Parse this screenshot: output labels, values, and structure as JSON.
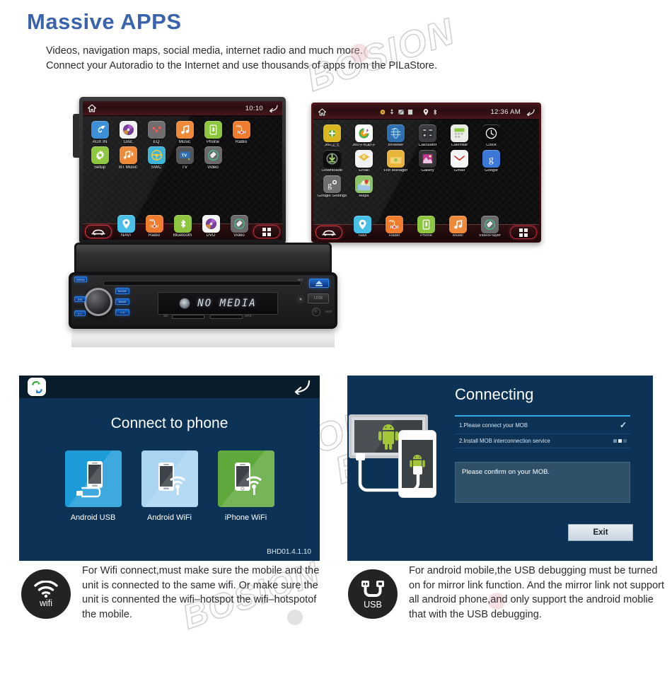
{
  "header": {
    "title": "Massive APPS",
    "title_color": "#3b63ad",
    "lines": [
      "Videos, navigation maps, social media, internet radio and much more.",
      "Connect your Autoradio to the Internet and use thousands of apps from the PILaStore."
    ]
  },
  "watermark": {
    "text": "BOSION"
  },
  "left_screen": {
    "statusbar": {
      "time": "10:10",
      "home_icon": "home-icon",
      "back_icon": "back-arrow-icon"
    },
    "apps": [
      {
        "label": "AUX IN",
        "icon": "aux-plug-icon",
        "color": "#3d8fd8"
      },
      {
        "label": "Disc",
        "icon": "disc-icon",
        "color": "#f2f2f2"
      },
      {
        "label": "EQ",
        "icon": "equalizer-icon",
        "color": "#6e6e70"
      },
      {
        "label": "Music",
        "icon": "music-note-icon",
        "color": "#ef8a3a"
      },
      {
        "label": "Phone",
        "icon": "bluetooth-phone-icon",
        "color": "#8ec63f"
      },
      {
        "label": "Radio",
        "icon": "fm-radio-icon",
        "color": "#f07d2e"
      },
      {
        "label": "Setup",
        "icon": "gear-icon",
        "color": "#8ec63f"
      },
      {
        "label": "BT Music",
        "icon": "bt-music-icon",
        "color": "#ef8a3a"
      },
      {
        "label": "SWC",
        "icon": "steering-wheel-icon",
        "color": "#3fb3d8"
      },
      {
        "label": "TV",
        "icon": "tv-icon",
        "color": "#555558"
      },
      {
        "label": "Video",
        "icon": "video-icon",
        "color": "#6a6a6d"
      }
    ],
    "dock": [
      {
        "label": "NAVI",
        "icon": "map-pin-icon",
        "color": "#49c0e8"
      },
      {
        "label": "Radio",
        "icon": "fm-radio-icon",
        "color": "#f07d2e"
      },
      {
        "label": "Bluetooth",
        "icon": "bluetooth-icon",
        "color": "#8ec63f"
      },
      {
        "label": "DVD",
        "icon": "disc-icon",
        "color": "#f4f4f4"
      },
      {
        "label": "Video",
        "icon": "video-icon",
        "color": "#6a6a6d"
      }
    ],
    "dock_left_icon": "car-icon",
    "dock_right_icon": "app-grid-icon"
  },
  "right_screen": {
    "statusbar": {
      "time": "12:36 AM",
      "home_icon": "home-icon",
      "back_icon": "back-arrow-icon",
      "icons": [
        "sync-icon",
        "usb-icon",
        "sd-card-icon",
        "battery-icon",
        "location-icon",
        "bluetooth-icon"
      ]
    },
    "apps": [
      {
        "label": "360卫土",
        "icon": "360-security-icon",
        "color": "#d9b521"
      },
      {
        "label": "360手机助手",
        "icon": "360-assistant-icon",
        "color": "#fbfbfb"
      },
      {
        "label": "Browser",
        "icon": "globe-browser-icon",
        "color": "#2f6fb0"
      },
      {
        "label": "Calculator",
        "icon": "calculator-icon",
        "color": "#3d3d40"
      },
      {
        "label": "Calendar",
        "icon": "calendar-icon",
        "color": "#e9eae4"
      },
      {
        "label": "Clock",
        "icon": "clock-icon",
        "color": "#0d0d0e"
      },
      {
        "label": "Downloads",
        "icon": "download-icon",
        "color": "#0d0d0e"
      },
      {
        "label": "Email",
        "icon": "email-icon",
        "color": "#f2f2f2"
      },
      {
        "label": "File Manager",
        "icon": "folder-icon",
        "color": "#e8b53a"
      },
      {
        "label": "Gallery",
        "icon": "gallery-icon",
        "color": "#333336"
      },
      {
        "label": "Gmail",
        "icon": "gmail-icon",
        "color": "#f4f4f4"
      },
      {
        "label": "Google",
        "icon": "google-g-icon",
        "color": "#3b78d8"
      },
      {
        "label": "Google Settings",
        "icon": "google-settings-icon",
        "color": "#6f6f72"
      },
      {
        "label": "Maps",
        "icon": "maps-icon",
        "color": "#8ec26a"
      }
    ],
    "dock": [
      {
        "label": "Navi",
        "icon": "map-pin-icon",
        "color": "#49c0e8"
      },
      {
        "label": "Radio",
        "icon": "fm-radio-icon",
        "color": "#f07d2e"
      },
      {
        "label": "Phone",
        "icon": "bluetooth-phone-icon",
        "color": "#8ec63f"
      },
      {
        "label": "Music",
        "icon": "music-note-icon",
        "color": "#ef8a3a"
      },
      {
        "label": "VideoPlayer",
        "icon": "video-icon",
        "color": "#6a6a6d"
      }
    ],
    "dock_left_icon": "car-icon",
    "dock_right_icon": "app-grid-icon"
  },
  "head_unit": {
    "display_text": "NO MEDIA",
    "keys_left": [
      "MENU",
      "DIS",
      "|<<"
    ],
    "keys_right": [
      "MODE",
      "BAND",
      ">>|"
    ],
    "usb_label": "USB",
    "aux_label": "AUX",
    "sd_label": "SD",
    "gps_label": "GPS",
    "eject_icon": "eject-icon",
    "reset_label": "RESET",
    "mic_label": "MIC"
  },
  "connect_panel": {
    "app_icon": "mirror-link-icon",
    "back_icon": "back-arrow-icon",
    "title": "Connect to phone",
    "version": "BHD01.4.1.10",
    "options": [
      {
        "label": "Android USB",
        "icon": "phone-usb-icon",
        "color": "#1d9bd8"
      },
      {
        "label": "Android WiFi",
        "icon": "phone-wifi-icon",
        "color": "#a9d5f2"
      },
      {
        "label": "iPhone WiFi",
        "icon": "iphone-wifi-icon",
        "color": "#5fa83c"
      }
    ]
  },
  "connecting_panel": {
    "title": "Connecting",
    "steps": [
      {
        "text": "1.Please connect your MOB",
        "status": "check"
      },
      {
        "text": "2.Install MOB interconnection service",
        "status": "dots"
      }
    ],
    "message": "Please confirm on your MOB.",
    "exit_label": "Exit",
    "illustration": {
      "monitor_icon": "android-robot-icon",
      "phone_icon": "android-robot-icon",
      "cable_icon": "usb-cable-icon"
    }
  },
  "notes": [
    {
      "badge_icon": "wifi-icon",
      "badge_label": "wifi",
      "text": "For Wifi connect,must make sure the mobile and the unit is connected to the same wifi. Or make sure the unit is connented the wifi–hotspot the wifi–hotspotof the mobile."
    },
    {
      "badge_icon": "usb-icon",
      "badge_label": "USB",
      "text": "For android mobile,the USB debugging must be turned on for mirror link function. And the mirror link not support all android phone,and only support the android moblie that with the USB debugging."
    }
  ]
}
